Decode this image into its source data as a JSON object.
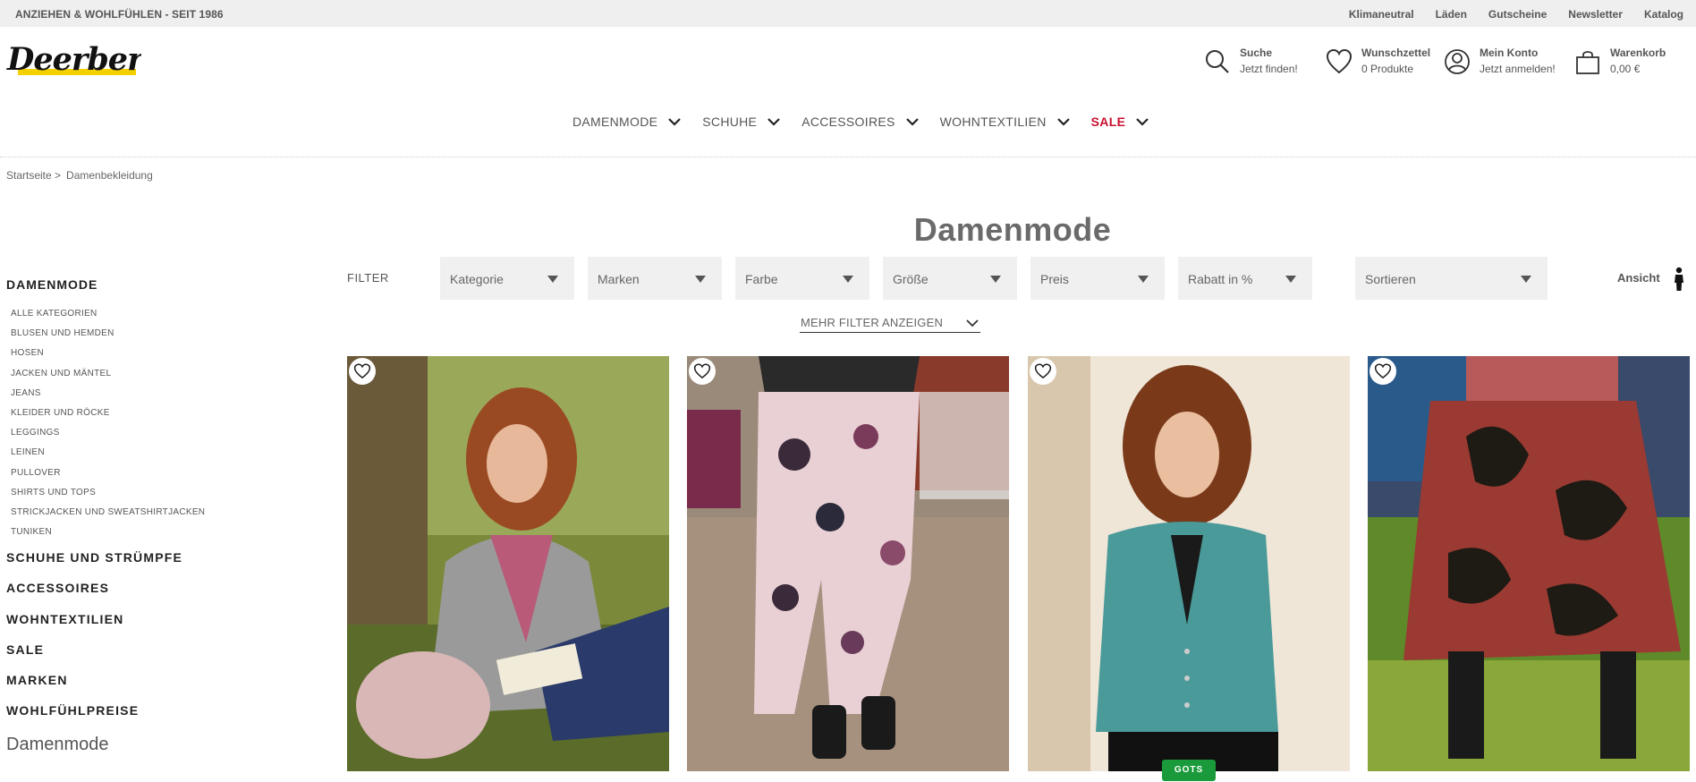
{
  "topbar": {
    "tagline": "ANZIEHEN & WOHLFÜHLEN - SEIT 1986",
    "links": [
      "Klimaneutral",
      "Läden",
      "Gutscheine",
      "Newsletter",
      "Katalog"
    ]
  },
  "brand": {
    "logo_text": "Deerberg",
    "accent_color": "#f5d000"
  },
  "header": {
    "search": {
      "title": "Suche",
      "subtitle": "Jetzt finden!"
    },
    "wishlist": {
      "title": "Wunschzettel",
      "subtitle": "0 Produkte"
    },
    "account": {
      "title": "Mein Konto",
      "subtitle": "Jetzt anmelden!"
    },
    "cart": {
      "title": "Warenkorb",
      "subtitle": "0,00 €"
    }
  },
  "nav": [
    "DAMENMODE",
    "SCHUHE",
    "ACCESSOIRES",
    "WOHNTEXTILIEN",
    "SALE"
  ],
  "sale_color": "#c8102e",
  "breadcrumb": [
    "Startseite >",
    "Damenbekleidung"
  ],
  "page_title": "Damenmode",
  "sidebar": {
    "heading": "DAMENMODE",
    "subcategories": [
      "ALLE KATEGORIEN",
      "BLUSEN UND HEMDEN",
      "HOSEN",
      "JACKEN UND MÄNTEL",
      "JEANS",
      "KLEIDER UND RÖCKE",
      "LEGGINGS",
      "LEINEN",
      "PULLOVER",
      "SHIRTS UND TOPS",
      "STRICKJACKEN UND SWEATSHIRTJACKEN",
      "TUNIKEN"
    ],
    "categories": [
      "SCHUHE UND STRÜMPFE",
      "ACCESSOIRES",
      "WOHNTEXTILIEN",
      "SALE",
      "MARKEN",
      "WOHLFÜHLPREISE"
    ],
    "footer": "Damenmode"
  },
  "filters": {
    "label": "FILTER",
    "selects": [
      "Kategorie",
      "Marken",
      "Farbe",
      "Größe",
      "Preis",
      "Rabatt in %"
    ],
    "sort": "Sortieren",
    "view_label": "Ansicht",
    "more": "MEHR FILTER ANZEIGEN"
  },
  "products": [
    {
      "image": "woman-grey-jacket-pink-scarf",
      "wishlist_icon": "heart-icon"
    },
    {
      "image": "floral-print-trousers",
      "wishlist_icon": "heart-icon"
    },
    {
      "image": "woman-teal-cardigan",
      "wishlist_icon": "heart-icon"
    },
    {
      "image": "red-black-print-culottes",
      "wishlist_icon": "heart-icon"
    }
  ],
  "badge": "GOTS",
  "badge_color": "#1a9a3a"
}
